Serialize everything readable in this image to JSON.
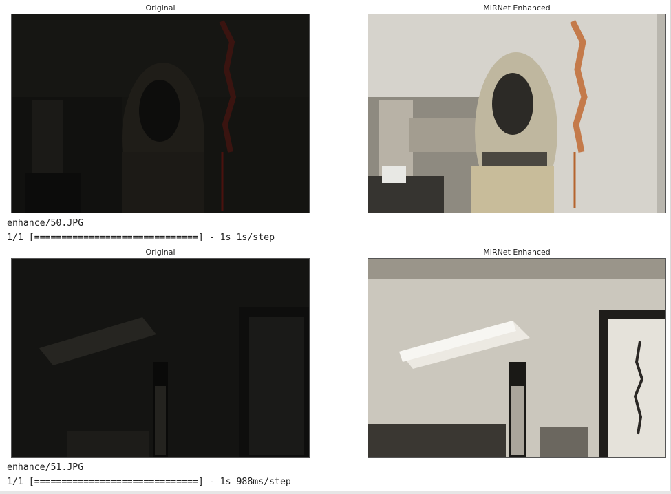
{
  "outputs": [
    {
      "original_title": "Original",
      "enhanced_title": "MIRNet Enhanced",
      "filename_line": "enhance/50.JPG",
      "progress_line": "1/1 [==============================] - 1s 1s/step"
    },
    {
      "original_title": "Original",
      "enhanced_title": "MIRNet Enhanced",
      "filename_line": "enhance/51.JPG",
      "progress_line": "1/1 [==============================] - 1s 988ms/step"
    }
  ]
}
